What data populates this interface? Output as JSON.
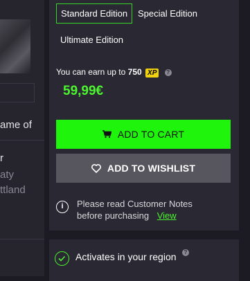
{
  "editions": {
    "standard": "Standard Edition",
    "special": "Special Edition",
    "ultimate": "Ultimate Edition"
  },
  "earn": {
    "prefix": "You can earn up to",
    "amount": "750",
    "badge": "XP",
    "help": "?"
  },
  "price": "59,99€",
  "buttons": {
    "add_to_cart": "ADD TO CART",
    "add_to_wishlist": "ADD TO WISHLIST"
  },
  "notes": {
    "icon": "i",
    "line1": "Please read Customer Notes",
    "line2": "before purchasing",
    "link": "View"
  },
  "region": {
    "label": "Activates in your region",
    "help": "?"
  },
  "left_column": {
    "line1": "ame of",
    "line2": "r",
    "line3": "aty",
    "line4": "ttland"
  },
  "colors": {
    "accent_green": "#1ff40c",
    "price_green": "#4cf52f",
    "xp_yellow": "#f0d20f",
    "panel_bg": "#2a2832",
    "page_bg": "#1c1a23"
  }
}
